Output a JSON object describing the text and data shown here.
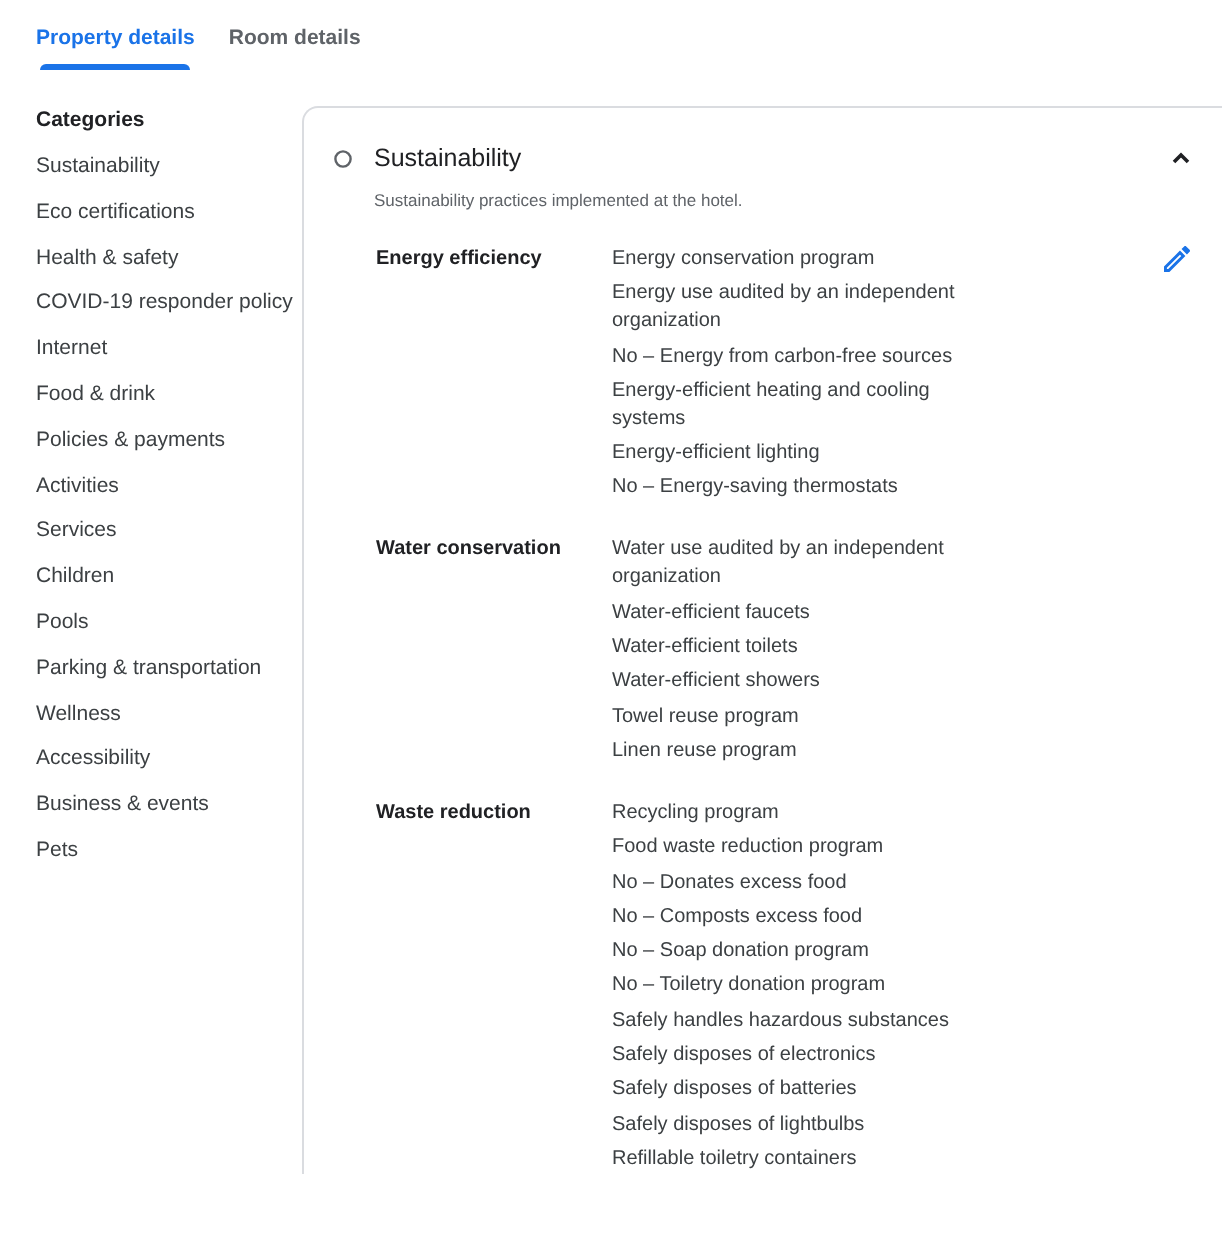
{
  "tabs": [
    {
      "label": "Property details",
      "selected": true
    },
    {
      "label": "Room details",
      "selected": false
    }
  ],
  "sidebar": {
    "title": "Categories",
    "items": [
      "Sustainability",
      "Eco certifications",
      "Health & safety",
      "COVID-19 responder policy",
      "Internet",
      "Food & drink",
      "Policies & payments",
      "Activities",
      "Services",
      "Children",
      "Pools",
      "Parking & transportation",
      "Wellness",
      "Accessibility",
      "Business & events",
      "Pets"
    ]
  },
  "section": {
    "title": "Sustainability",
    "description": "Sustainability practices implemented at the hotel.",
    "expanded": true,
    "groups": [
      {
        "label": "Energy efficiency",
        "items": [
          "Energy conservation program",
          "Energy use audited by an independent organization",
          "No – Energy from carbon-free sources",
          "Energy-efficient heating and cooling systems",
          "Energy-efficient lighting",
          "No – Energy-saving thermostats"
        ]
      },
      {
        "label": "Water conservation",
        "items": [
          "Water use audited by an independent organization",
          "Water-efficient faucets",
          "Water-efficient toilets",
          "Water-efficient showers",
          "Towel reuse program",
          "Linen reuse program"
        ]
      },
      {
        "label": "Waste reduction",
        "items": [
          "Recycling program",
          "Food waste reduction program",
          "No – Donates excess food",
          "No – Composts excess food",
          "No – Soap donation program",
          "No – Toiletry donation program",
          "Safely handles hazardous substances",
          "Safely disposes of electronics",
          "Safely disposes of batteries",
          "Safely disposes of lightbulbs",
          "Refillable toiletry containers"
        ]
      }
    ]
  }
}
